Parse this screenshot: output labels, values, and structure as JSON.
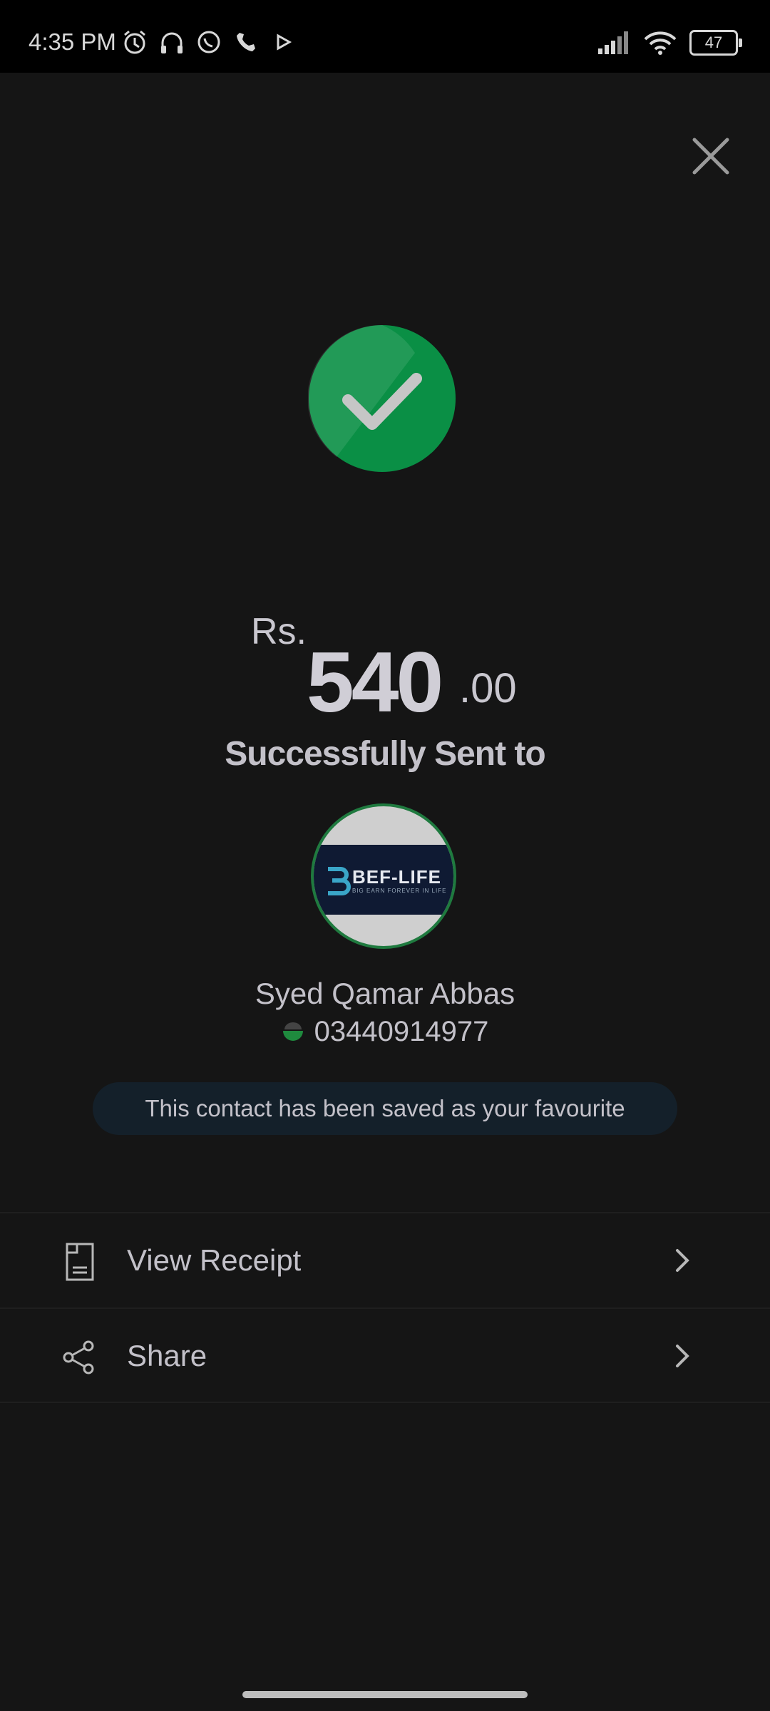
{
  "status_bar": {
    "time": "4:35 PM",
    "battery": "47",
    "left_icons": [
      "alarm-icon",
      "headphones-icon",
      "whatsapp-icon",
      "phone-icon",
      "play-icon"
    ],
    "right_icons": [
      "signal-icon",
      "wifi-icon",
      "battery-icon"
    ]
  },
  "close_icon": "close-icon",
  "success_icon": "check-circle-icon",
  "amount": {
    "currency": "Rs.",
    "whole": "540",
    "decimal": ".00"
  },
  "success_message": "Successfully Sent to",
  "recipient": {
    "avatar_logo_text": "BEF-LIFE",
    "avatar_logo_sub": "BIG EARN FOREVER IN LIFE",
    "name": "Syed Qamar Abbas",
    "phone": "03440914977",
    "network_icon": "jazz-network-icon"
  },
  "favourite_notice": "This contact has been saved as your favourite",
  "actions": [
    {
      "label": "View Receipt",
      "icon": "receipt-icon"
    },
    {
      "label": "Share",
      "icon": "share-icon"
    }
  ],
  "colors": {
    "background": "#151515",
    "success_green": "#0a8f45",
    "text": "#c9c7cf",
    "pill_bg": "#14202a"
  }
}
